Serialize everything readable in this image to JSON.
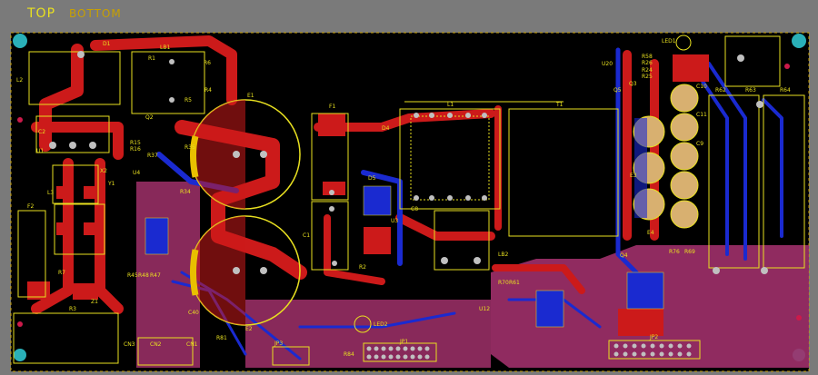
{
  "layers": {
    "top_label": "TOP",
    "bottom_label": "BOTTOM"
  },
  "colors": {
    "background": "#7a7a7a",
    "board": "#000000",
    "top_copper": "#cc1a1a",
    "bottom_copper": "#1a2ad0",
    "silkscreen": "#e8e020",
    "pad": "#c0c0c0",
    "mounting_hole": "#2ab0b8",
    "overlap": "#a0306a"
  },
  "designators": {
    "D1": "D1",
    "LB1": "LB1",
    "L2": "L2",
    "C2": "C2",
    "U1": "U1",
    "X2": "X2",
    "L3": "L3",
    "F2": "F2",
    "R7": "R7",
    "R3": "R3",
    "Z1": "Z1",
    "CN3": "CN3",
    "CN2": "CN2",
    "CN1": "CN1",
    "E1": "E1",
    "E2": "E2",
    "C1": "C1",
    "F1": "F1",
    "L1": "L1",
    "T1": "T1",
    "R2": "R2",
    "D4": "D4",
    "D5": "D5",
    "U3": "U3",
    "LB2": "LB2",
    "JP1": "JP1",
    "JP2": "JP2",
    "JP3": "JP3",
    "LED1": "LED1",
    "U20": "U20",
    "Q3": "Q3",
    "Q5": "Q5",
    "R62": "R62",
    "R63": "R63",
    "R64": "R64",
    "C10": "C10",
    "E3": "E3",
    "E4": "E4",
    "C8": "C8",
    "R1": "R1",
    "Q2": "Q2",
    "R6": "R6",
    "R4": "R4",
    "R5": "R5",
    "R35": "R35",
    "R45": "R45",
    "R48": "R48",
    "R47": "R47",
    "R34": "R34",
    "U4": "U4",
    "Y1": "Y1",
    "R70": "R70",
    "R61": "R61",
    "U12": "U12",
    "Q4": "Q4",
    "R24": "R24",
    "R69": "R69",
    "R81": "R81",
    "LED2": "LED2",
    "C40": "C40",
    "R84": "R84",
    "R37": "R37",
    "R15": "R15",
    "R16": "R16",
    "R58": "R58",
    "R26": "R26",
    "R25": "R25",
    "R76": "R76",
    "C9": "C9",
    "C11": "C11"
  }
}
